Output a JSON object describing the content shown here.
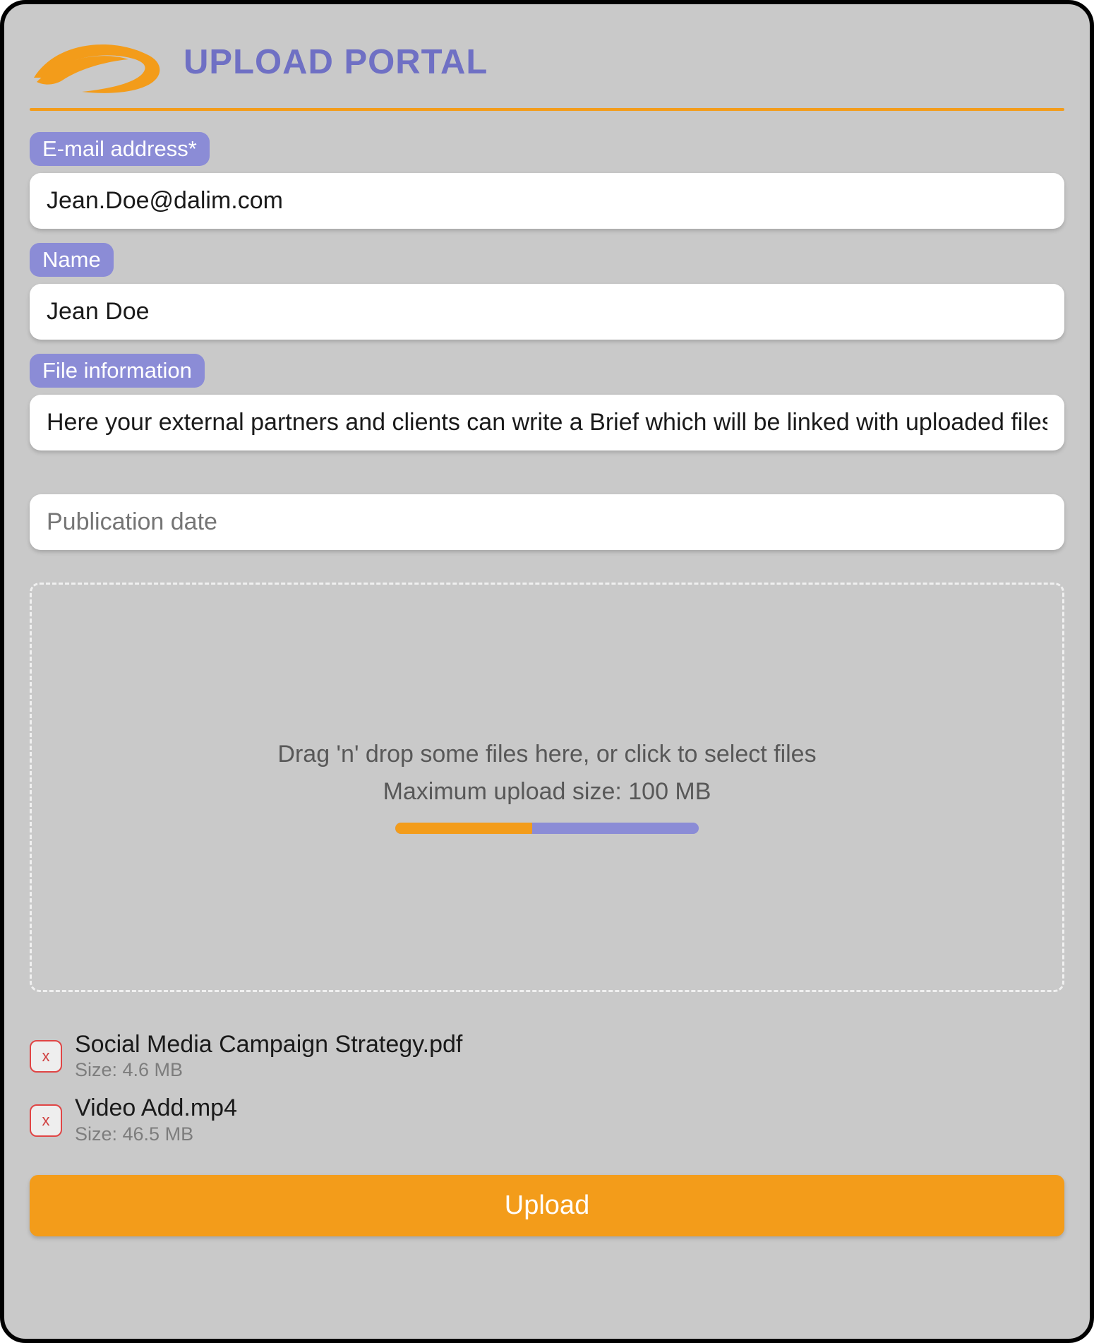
{
  "colors": {
    "accent": "#f39c1a",
    "primary": "#6f70c4",
    "pill": "#8b8cd6"
  },
  "header": {
    "title": "UPLOAD PORTAL"
  },
  "form": {
    "email": {
      "label": "E-mail address*",
      "value": "Jean.Doe@dalim.com"
    },
    "name": {
      "label": "Name",
      "value": "Jean Doe"
    },
    "file_info": {
      "label": "File information",
      "value": "Here your external partners and clients can write a Brief which will be linked with uploaded files"
    },
    "publication_date": {
      "placeholder": "Publication date",
      "value": ""
    }
  },
  "dropzone": {
    "line1": "Drag 'n' drop some files here, or click to select files",
    "line2": "Maximum upload size: 100 MB",
    "progress_percent": 45
  },
  "files": [
    {
      "name": "Social Media Campaign Strategy.pdf",
      "size_label": "Size: 4.6 MB",
      "remove_label": "x"
    },
    {
      "name": "Video Add.mp4",
      "size_label": "Size: 46.5 MB",
      "remove_label": "x"
    }
  ],
  "actions": {
    "upload_label": "Upload"
  }
}
